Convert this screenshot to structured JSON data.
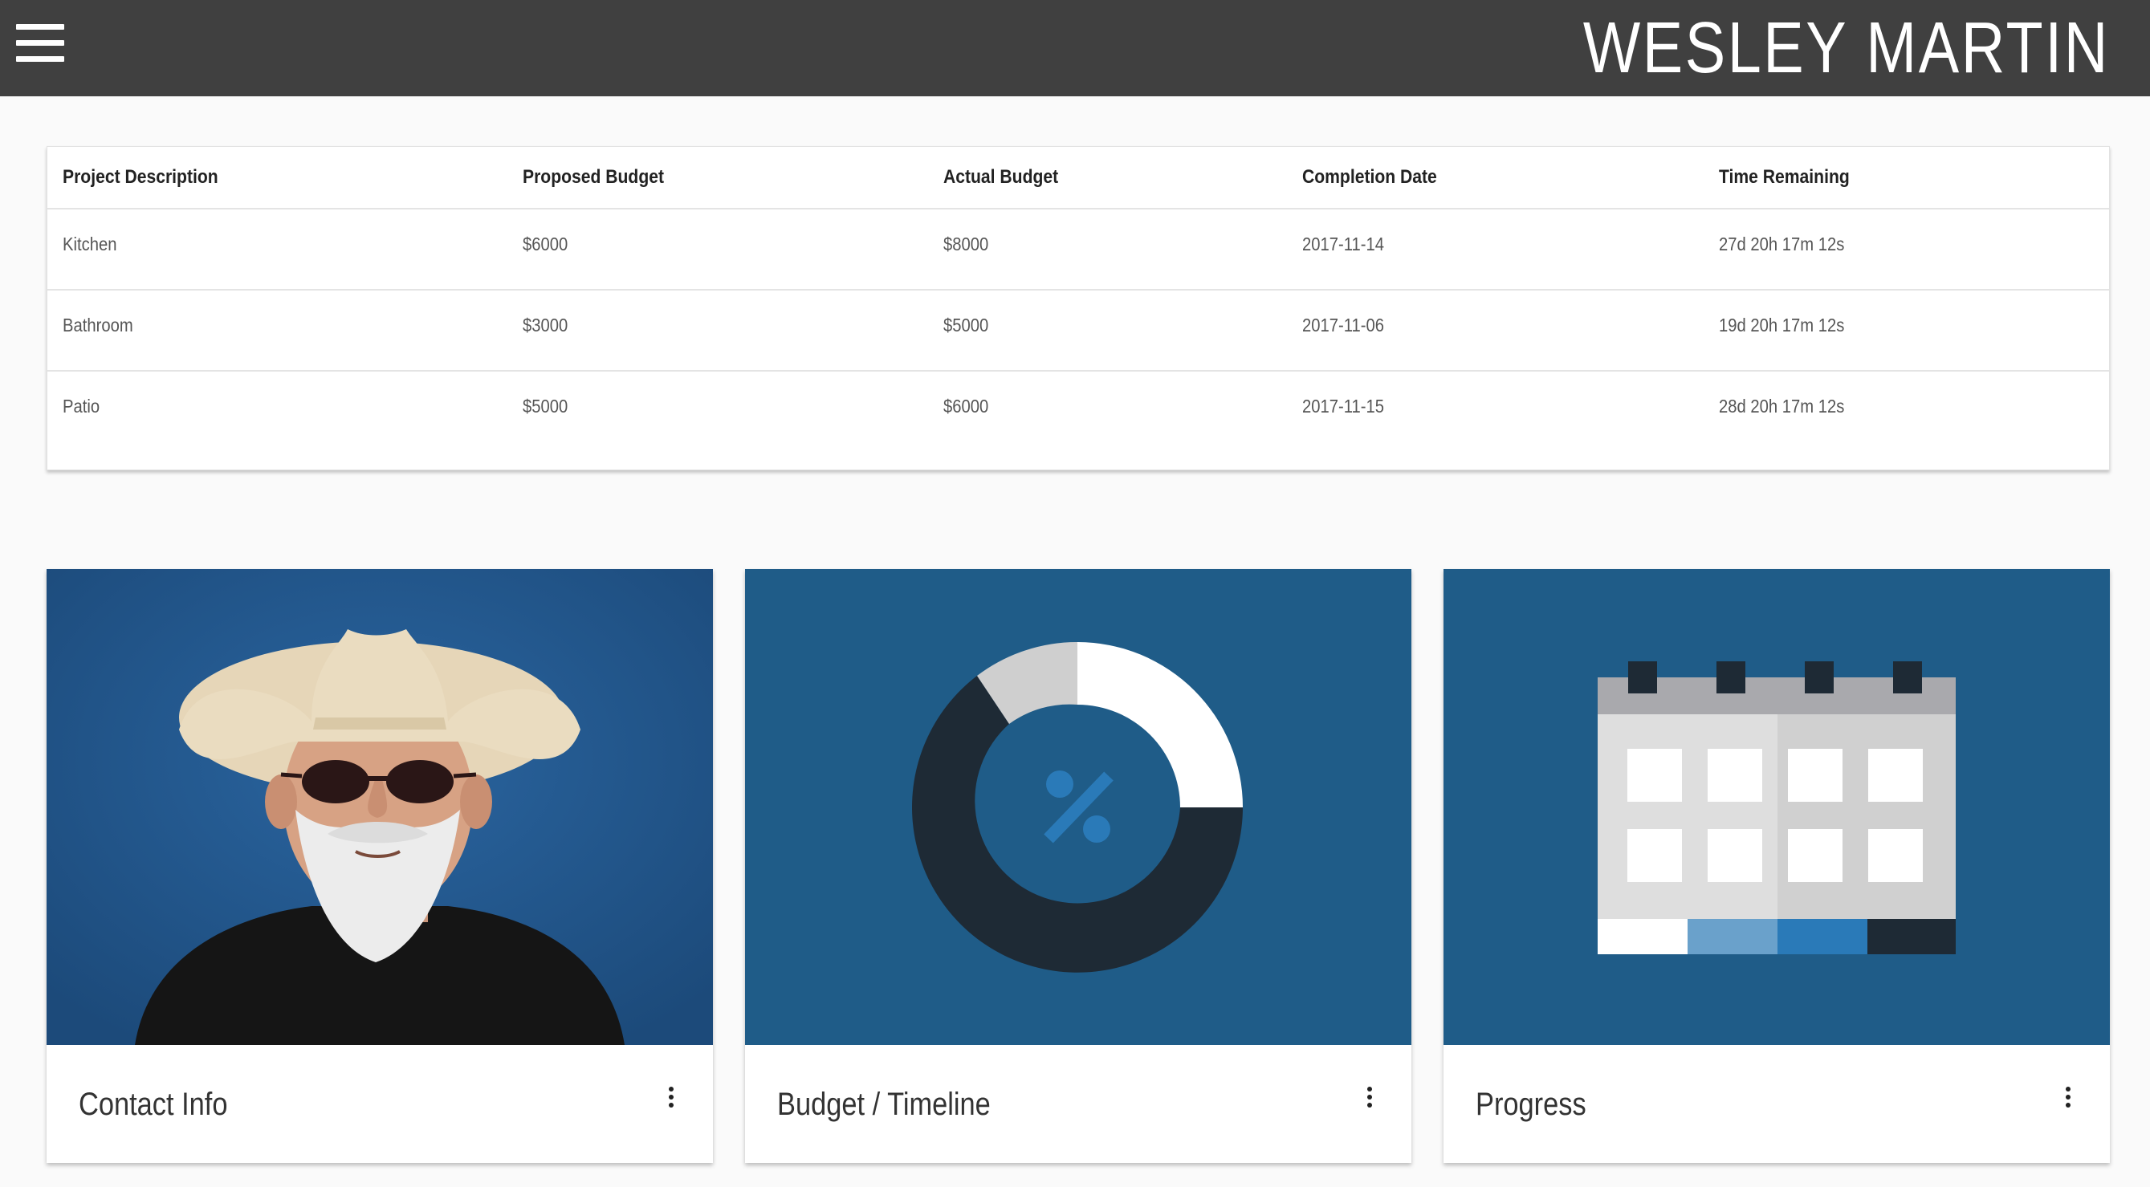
{
  "header": {
    "menu_icon": "hamburger-menu-icon",
    "user_name": "WESLEY MARTIN"
  },
  "projects_table": {
    "columns": [
      "Project Description",
      "Proposed Budget",
      "Actual Budget",
      "Completion Date",
      "Time Remaining"
    ],
    "rows": [
      [
        "Kitchen",
        "$6000",
        "$8000",
        "2017-11-14",
        "27d 20h 17m 12s"
      ],
      [
        "Bathroom",
        "$3000",
        "$5000",
        "2017-11-06",
        "19d 20h 17m 12s"
      ],
      [
        "Patio",
        "$5000",
        "$6000",
        "2017-11-15",
        "28d 20h 17m 12s"
      ]
    ]
  },
  "cards": [
    {
      "title": "Contact Info",
      "image": "portrait-photo",
      "menu_icon": "more-vert-icon"
    },
    {
      "title": "Budget / Timeline",
      "image": "donut-percent-icon",
      "menu_icon": "more-vert-icon"
    },
    {
      "title": "Progress",
      "image": "calendar-icon",
      "menu_icon": "more-vert-icon"
    }
  ],
  "colors": {
    "header_bg": "#404040",
    "card_media_bg": "#1f5c88",
    "accent_blue": "#2a7ab8",
    "dark_navy": "#1e2a35"
  }
}
